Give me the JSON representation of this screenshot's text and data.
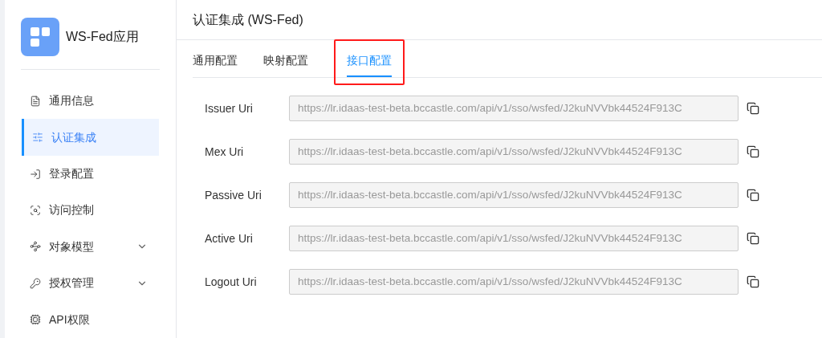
{
  "app": {
    "title": "WS-Fed应用"
  },
  "sidebar": {
    "items": [
      {
        "label": "通用信息",
        "selected": false,
        "has_submenu": false
      },
      {
        "label": "认证集成",
        "selected": true,
        "has_submenu": false
      },
      {
        "label": "登录配置",
        "selected": false,
        "has_submenu": false
      },
      {
        "label": "访问控制",
        "selected": false,
        "has_submenu": false
      },
      {
        "label": "对象模型",
        "selected": false,
        "has_submenu": true
      },
      {
        "label": "授权管理",
        "selected": false,
        "has_submenu": true
      },
      {
        "label": "API权限",
        "selected": false,
        "has_submenu": false
      }
    ]
  },
  "page": {
    "title": "认证集成 (WS-Fed)"
  },
  "tabs": [
    {
      "label": "通用配置",
      "selected": false
    },
    {
      "label": "映射配置",
      "selected": false
    },
    {
      "label": "接口配置",
      "selected": true
    }
  ],
  "fields": [
    {
      "label": "Issuer Uri",
      "value": "https://lr.idaas-test-beta.bccastle.com/api/v1/sso/wsfed/J2kuNVVbk44524F913C"
    },
    {
      "label": "Mex Uri",
      "value": "https://lr.idaas-test-beta.bccastle.com/api/v1/sso/wsfed/J2kuNVVbk44524F913C"
    },
    {
      "label": "Passive Uri",
      "value": "https://lr.idaas-test-beta.bccastle.com/api/v1/sso/wsfed/J2kuNVVbk44524F913C"
    },
    {
      "label": "Active Uri",
      "value": "https://lr.idaas-test-beta.bccastle.com/api/v1/sso/wsfed/J2kuNVVbk44524F913C"
    },
    {
      "label": "Logout Uri",
      "value": "https://lr.idaas-test-beta.bccastle.com/api/v1/sso/wsfed/J2kuNVVbk44524F913C"
    }
  ]
}
